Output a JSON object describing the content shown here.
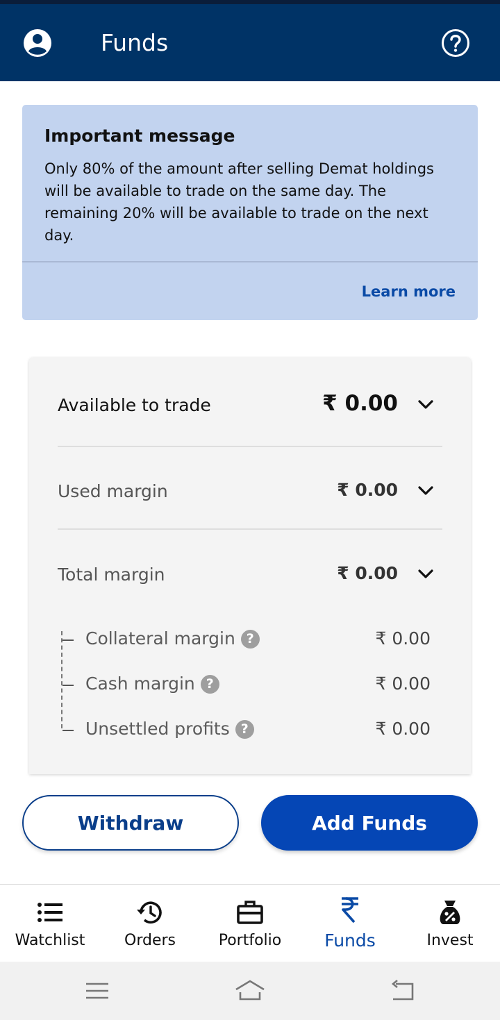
{
  "appbar": {
    "title": "Funds",
    "user_icon": "account-circle-icon",
    "help_icon": "help-circle-icon",
    "color": "#003366"
  },
  "notice": {
    "title": "Important message",
    "body": "Only 80% of the amount after selling Demat holdings will be available to trade on the same day. The remaining 20% will be available to trade on the next day.",
    "link": "Learn more",
    "background": "#c2d3ef"
  },
  "funds": {
    "available": {
      "label": "Available to trade",
      "value": "₹ 0.00"
    },
    "used": {
      "label": "Used margin",
      "value": "₹ 0.00"
    },
    "total": {
      "label": "Total margin",
      "value": "₹ 0.00"
    },
    "breakdown": [
      {
        "label": "Collateral margin",
        "value": "₹ 0.00"
      },
      {
        "label": "Cash margin",
        "value": "₹ 0.00"
      },
      {
        "label": "Unsettled profits",
        "value": "₹ 0.00"
      }
    ]
  },
  "actions": {
    "withdraw": "Withdraw",
    "add_funds": "Add Funds",
    "accent": "#0546b5"
  },
  "nav": {
    "active": "Funds",
    "items": [
      {
        "label": "Watchlist",
        "icon": "list-icon"
      },
      {
        "label": "Orders",
        "icon": "history-icon"
      },
      {
        "label": "Portfolio",
        "icon": "briefcase-icon"
      },
      {
        "label": "Funds",
        "icon": "rupee-icon"
      },
      {
        "label": "Invest",
        "icon": "money-bag-icon"
      }
    ]
  },
  "system_bar": {
    "icons": [
      "recents-icon",
      "home-icon",
      "back-icon"
    ]
  }
}
